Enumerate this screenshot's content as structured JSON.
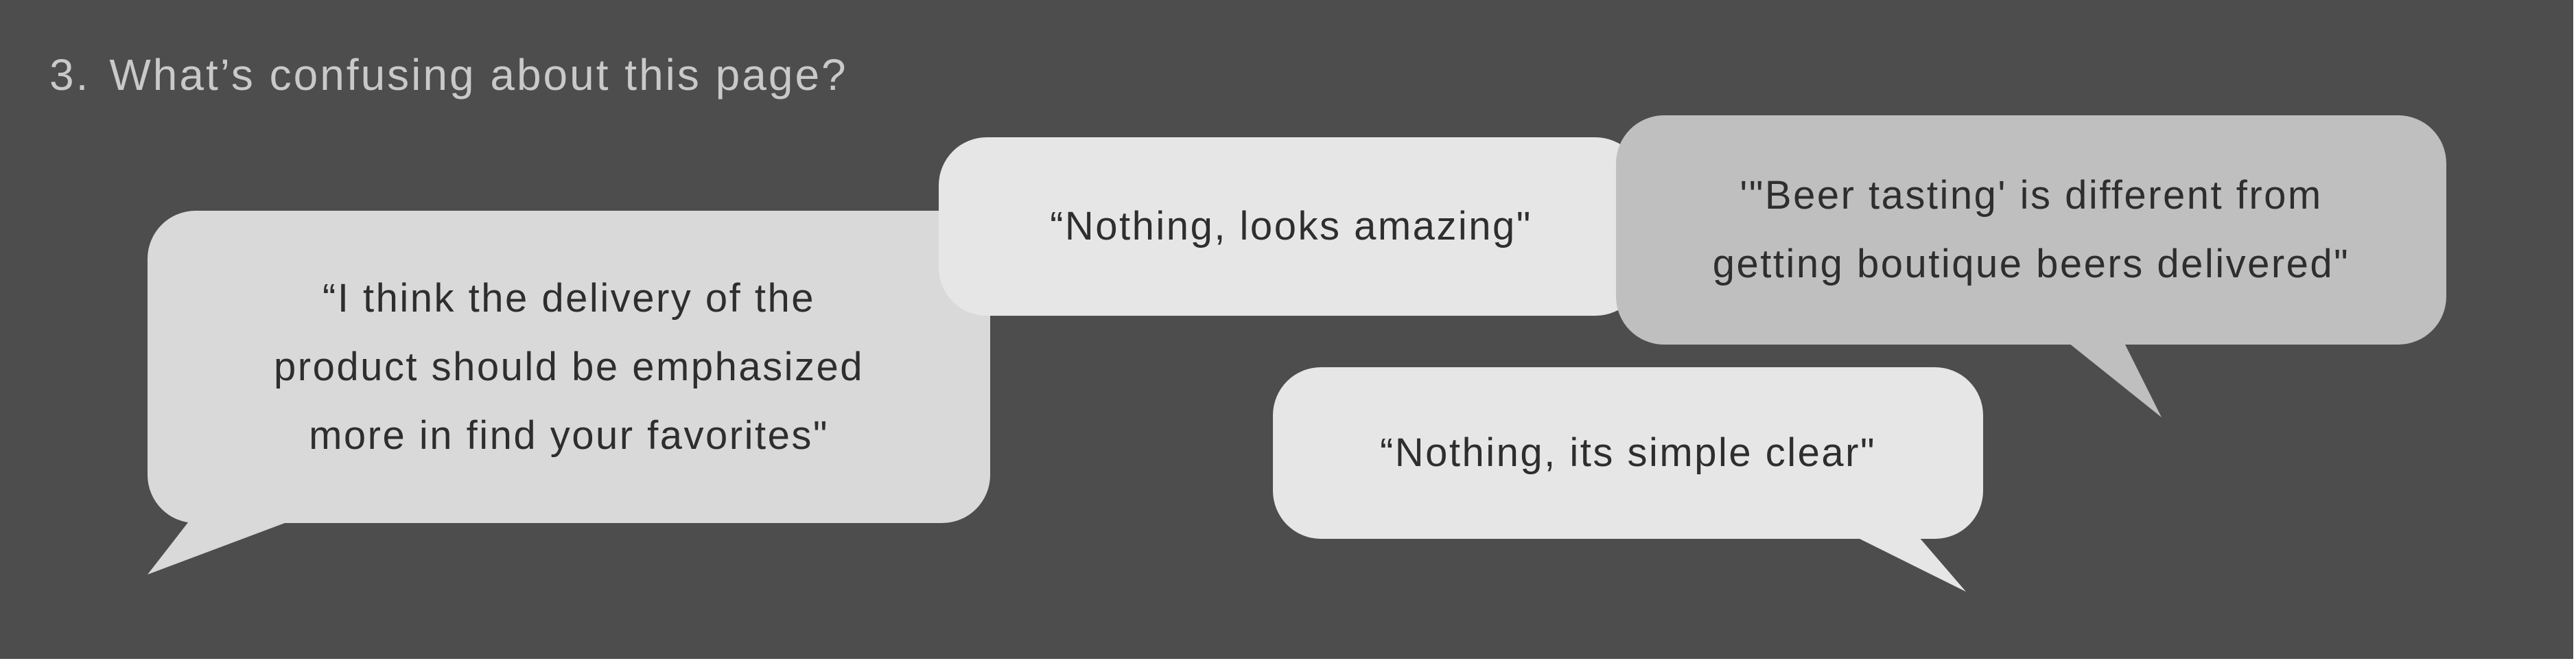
{
  "question": {
    "number": "3.",
    "text": "What’s confusing about this page?"
  },
  "bubbles": [
    {
      "line1": "“I think the delivery of the",
      "line2": "product should be emphasized",
      "line3": "more in find your favorites\""
    },
    {
      "line1": "“Nothing, looks amazing\""
    },
    {
      "line1": "'\"Beer tasting' is different from",
      "line2": "getting boutique beers delivered\""
    },
    {
      "line1": "“Nothing, its simple clear\""
    }
  ],
  "colors": {
    "background": "#4d4d4d",
    "question_text": "#c9c9c9",
    "bubble_light": "#e6e6e6",
    "bubble_mid": "#d9d9d9",
    "bubble_dark": "#bfbfbf",
    "bubble_text": "#2e2e2e"
  }
}
